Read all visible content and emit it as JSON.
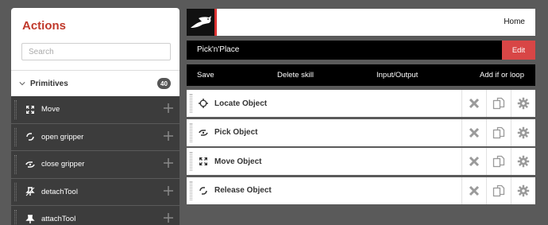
{
  "sidebar": {
    "title": "Actions",
    "search_placeholder": "Search",
    "section": {
      "label": "Primitives",
      "count": "40",
      "icon": "chevron-down-icon"
    },
    "items": [
      {
        "label": "Move",
        "icon": "move-arrows-icon"
      },
      {
        "label": "open gripper",
        "icon": "gripper-open-icon"
      },
      {
        "label": "close gripper",
        "icon": "gripper-close-icon"
      },
      {
        "label": "detachTool",
        "icon": "detach-pin-icon"
      },
      {
        "label": "attachTool",
        "icon": "attach-pin-icon"
      }
    ]
  },
  "header": {
    "home_label": "Home",
    "logo_icon": "bird-logo-icon"
  },
  "skill": {
    "name": "Pick'n'Place",
    "edit_label": "Edit"
  },
  "menu": {
    "save": "Save",
    "delete": "Delete skill",
    "io": "Input/Output",
    "add": "Add if or loop"
  },
  "steps": [
    {
      "label": "Locate Object",
      "icon": "crosshair-icon"
    },
    {
      "label": "Pick Object",
      "icon": "gripper-close-icon"
    },
    {
      "label": "Move Object",
      "icon": "move-arrows-icon"
    },
    {
      "label": "Release Object",
      "icon": "gripper-open-icon"
    }
  ],
  "colors": {
    "accent": "#c0392b",
    "edit_button": "#d84646",
    "sidebar_item_bg": "#3c3c3c",
    "page_bg": "#5a5a5a"
  }
}
